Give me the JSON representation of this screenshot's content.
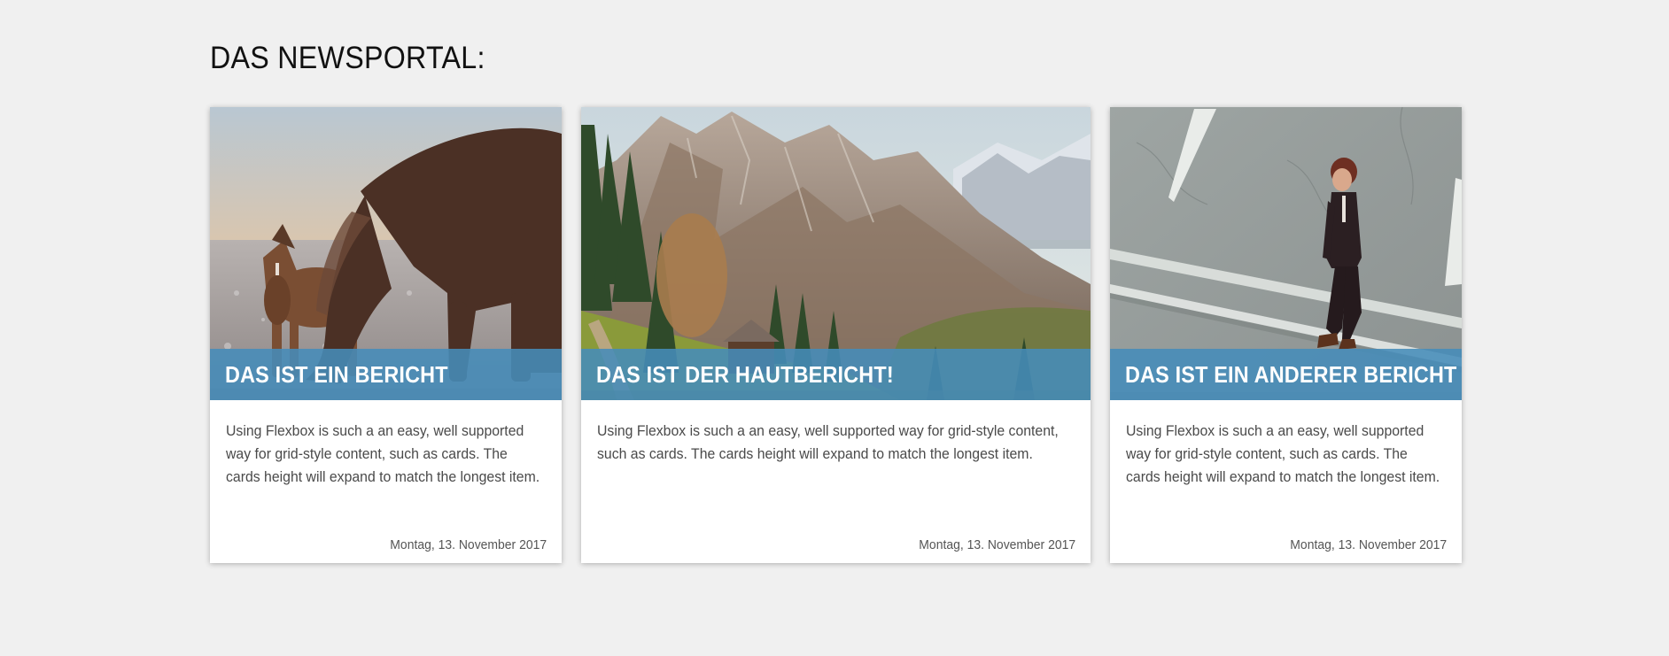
{
  "page": {
    "title": "DAS NEWSPORTAL:"
  },
  "colors": {
    "background": "#f0f0f0",
    "card_background": "#ffffff",
    "title_bar": "#468cb9",
    "title_text": "#ffffff"
  },
  "cards": [
    {
      "image_icon": "horses-photo",
      "title": "DAS IST EIN BERICHT",
      "text": "Using Flexbox is such a an easy, well supported way for grid-style content, such as cards. The cards height will expand to match the longest item.",
      "date": "Montag, 13. November 2017"
    },
    {
      "image_icon": "mountain-landscape-photo",
      "title": "DAS IST DER HAUTBERICHT!",
      "text": "Using Flexbox is such a an easy, well supported way for grid-style content, such as cards. The cards height will expand to match the longest item.",
      "date": "Montag, 13. November 2017"
    },
    {
      "image_icon": "man-walking-street-photo",
      "title": "DAS IST EIN ANDERER BERICHT",
      "text": "Using Flexbox is such a an easy, well supported way for grid-style content, such as cards. The cards height will expand to match the longest item.",
      "date": "Montag, 13. November 2017"
    }
  ]
}
